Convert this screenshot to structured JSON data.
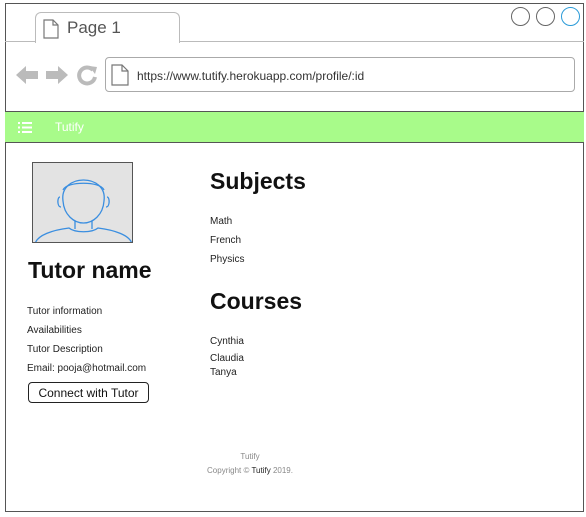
{
  "browser": {
    "tab_title": "Page 1",
    "url": "https://www.tutify.herokuapp.com/profile/:id"
  },
  "navbar": {
    "brand": "Tutify"
  },
  "profile": {
    "name": "Tutor name",
    "info": [
      "Tutor information",
      "Availabilities",
      "Tutor Description",
      "Email: pooja@hotmail.com"
    ],
    "connect_label": "Connect with Tutor"
  },
  "subjects": {
    "heading": "Subjects",
    "items": [
      "Math",
      "French",
      "Physics"
    ]
  },
  "courses": {
    "heading": "Courses",
    "items": [
      "Cynthia",
      "Claudia",
      "Tanya"
    ]
  },
  "footer": {
    "line1": "Tutify",
    "copyright_prefix": "Copyright © ",
    "copyright_brand": "Tutify",
    "copyright_suffix": " 2019."
  }
}
